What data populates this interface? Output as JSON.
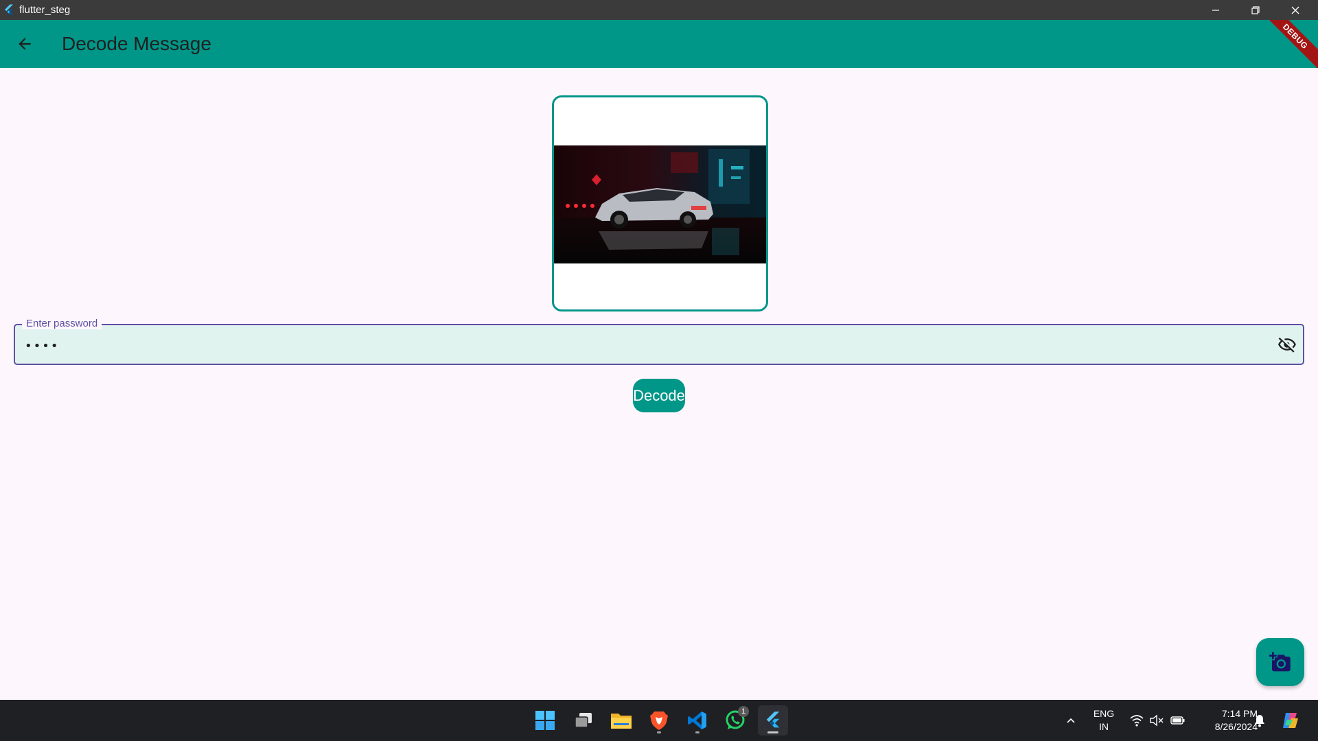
{
  "window": {
    "title": "flutter_steg",
    "controls": [
      "minimize-icon",
      "restore-icon",
      "close-icon"
    ]
  },
  "appbar": {
    "title": "Decode Message",
    "back_icon": "arrow-back-icon",
    "debug_banner": "DEBUG"
  },
  "image_preview": {
    "description_icon": "car-photo"
  },
  "password": {
    "label": "Enter password",
    "value": "••••",
    "toggle_icon": "visibility-off-icon"
  },
  "decode_button": {
    "label": "Decode"
  },
  "fab": {
    "icon": "add-a-photo-icon"
  },
  "taskbar": {
    "apps": [
      {
        "name": "start",
        "icon": "windows-icon"
      },
      {
        "name": "task-view",
        "icon": "task-view-icon"
      },
      {
        "name": "file-explorer",
        "icon": "folder-icon"
      },
      {
        "name": "brave",
        "icon": "brave-icon",
        "running": true
      },
      {
        "name": "vscode",
        "icon": "vscode-icon",
        "running": true
      },
      {
        "name": "whatsapp",
        "icon": "whatsapp-icon",
        "badge": "1"
      },
      {
        "name": "flutter-app",
        "icon": "flutter-icon",
        "active": true
      }
    ],
    "language_line1": "ENG",
    "language_line2": "IN",
    "time": "7:14 PM",
    "date": "8/26/2024"
  },
  "colors": {
    "primary": "#009688",
    "background": "#fdf7fd",
    "field_border": "#5e4fa2",
    "field_fill": "#e1f3ef",
    "titlebar": "#3b3b3b",
    "taskbar": "#1f2024",
    "debug": "#a31515"
  }
}
